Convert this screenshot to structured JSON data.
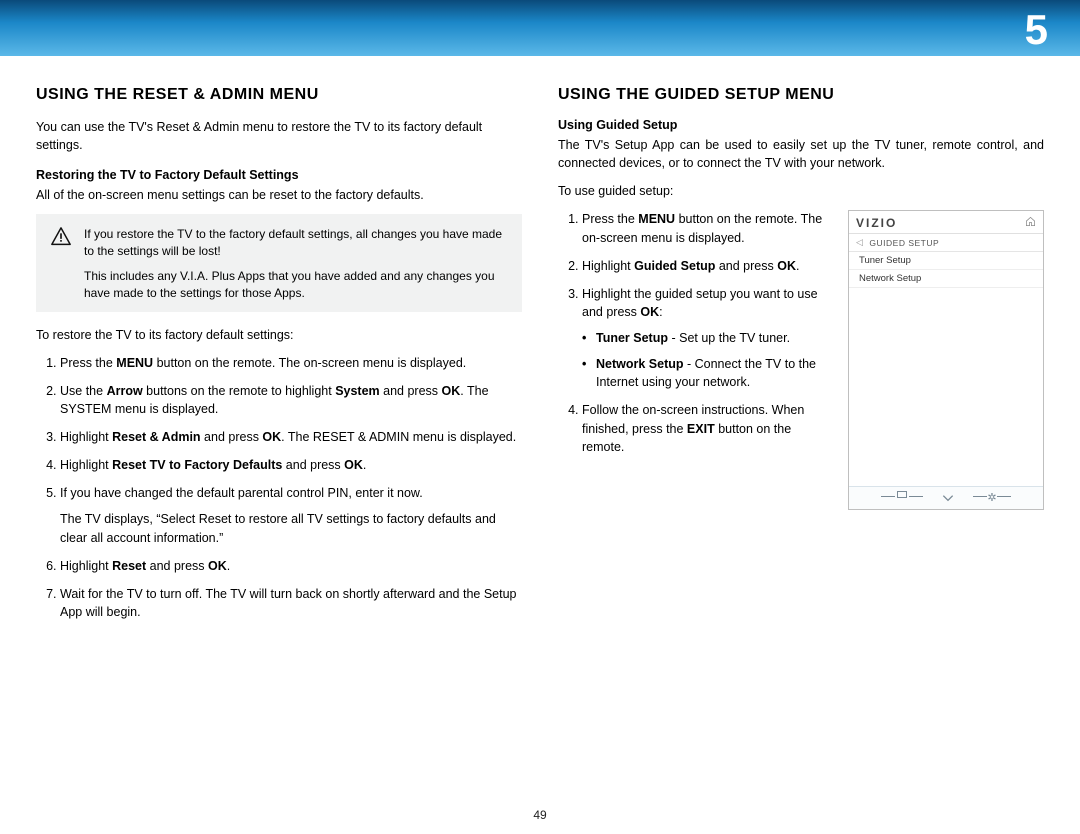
{
  "chapter_number": "5",
  "page_number": "49",
  "left": {
    "heading": "USING THE RESET & ADMIN MENU",
    "intro": "You can use the TV's Reset & Admin menu to restore the TV to its factory default settings.",
    "sub1": "Restoring the TV to Factory Default Settings",
    "sub1_p": "All of the on-screen menu settings can be reset to the factory defaults.",
    "warn1": "If you restore the TV to the factory default settings, all changes you have made to the settings will be lost!",
    "warn2": "This includes any V.I.A. Plus Apps that you have added and any changes you have made to the settings for those Apps.",
    "lead": "To restore the TV to its factory default settings:",
    "steps": {
      "s1a": "Press the ",
      "s1b": "MENU",
      "s1c": " button on the remote. The on-screen menu is displayed.",
      "s2a": "Use the ",
      "s2b": "Arrow",
      "s2c": " buttons on the remote to highlight ",
      "s2d": "System",
      "s2e": " and press ",
      "s2f": "OK",
      "s2g": ". The SYSTEM menu is displayed.",
      "s3a": "Highlight ",
      "s3b": "Reset & Admin",
      "s3c": " and press ",
      "s3d": "OK",
      "s3e": ". The RESET & ADMIN menu is displayed.",
      "s4a": "Highlight ",
      "s4b": "Reset TV to Factory Defaults",
      "s4c": " and press ",
      "s4d": "OK",
      "s4e": ".",
      "s5a": "If you have changed the default parental control PIN, enter it now.",
      "s5b": "The TV displays, “Select Reset to restore all TV settings to factory defaults and clear all account information.”",
      "s6a": "Highlight ",
      "s6b": "Reset",
      "s6c": " and press ",
      "s6d": "OK",
      "s6e": ".",
      "s7": "Wait for the TV to turn off. The TV will turn back on shortly afterward and the Setup App will begin."
    }
  },
  "right": {
    "heading": "USING THE GUIDED SETUP MENU",
    "sub1": "Using Guided Setup",
    "intro": "The TV's Setup App can be used to easily set up the TV tuner, remote control, and connected devices, or to connect the TV with your network.",
    "lead": "To use guided setup:",
    "steps": {
      "s1a": "Press the ",
      "s1b": "MENU",
      "s1c": " button on the remote. The on-screen menu is displayed.",
      "s2a": "Highlight ",
      "s2b": "Guided Setup",
      "s2c": " and press ",
      "s2d": "OK",
      "s2e": ".",
      "s3a": "Highlight the guided setup you want to use and press ",
      "s3b": "OK",
      "s3c": ":",
      "b1a": "Tuner Setup",
      "b1b": " - Set up the TV tuner.",
      "b2a": "Network Setup",
      "b2b": " - Connect the TV to the Internet using your network.",
      "s4a": "Follow the on-screen instructions. When finished, press the ",
      "s4b": "EXIT",
      "s4c": " button on the remote."
    }
  },
  "menu": {
    "logo": "VIZIO",
    "crumb": "GUIDED SETUP",
    "items": [
      "Tuner Setup",
      "Network Setup"
    ]
  }
}
